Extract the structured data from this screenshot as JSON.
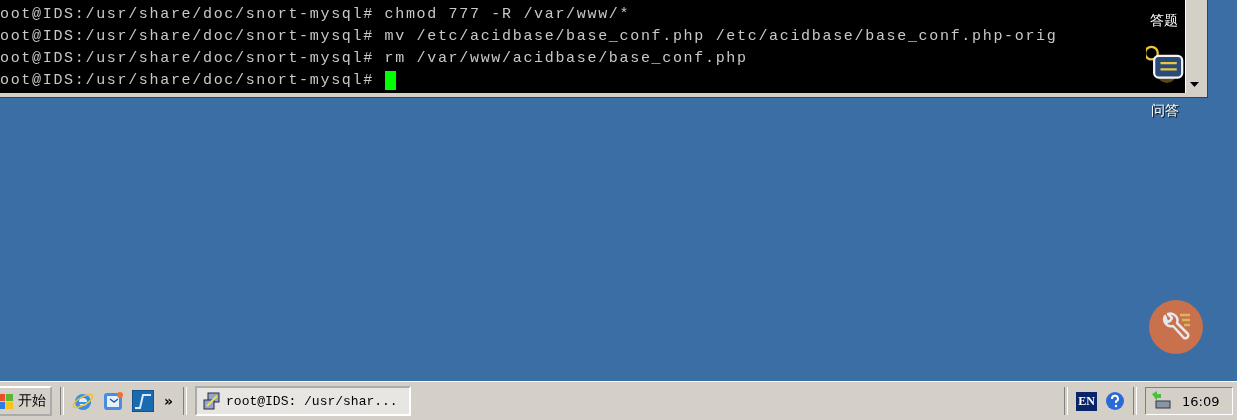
{
  "terminal": {
    "lines": [
      {
        "text": "oot@IDS:/usr/share/doc/snort-mysql# chmod 777 -R /var/www/*",
        "cursor": false
      },
      {
        "text": "oot@IDS:/usr/share/doc/snort-mysql# mv /etc/acidbase/base_conf.php /etc/acidbase/base_conf.php-orig",
        "cursor": false
      },
      {
        "text": "oot@IDS:/usr/share/doc/snort-mysql# rm /var/www/acidbase/base_conf.php",
        "cursor": false
      },
      {
        "text": "oot@IDS:/usr/share/doc/snort-mysql# ",
        "cursor": true
      }
    ]
  },
  "desktop_icons": [
    {
      "label": "答题",
      "kind": "label"
    },
    {
      "label": "问答",
      "kind": "chat"
    }
  ],
  "taskbar": {
    "start_button": {
      "label": "开始"
    },
    "quick_launch_more": "»",
    "tasks": [
      {
        "label": "root@IDS: /usr/shar...",
        "selected": true
      }
    ],
    "language": "EN",
    "clock": "16:09"
  }
}
